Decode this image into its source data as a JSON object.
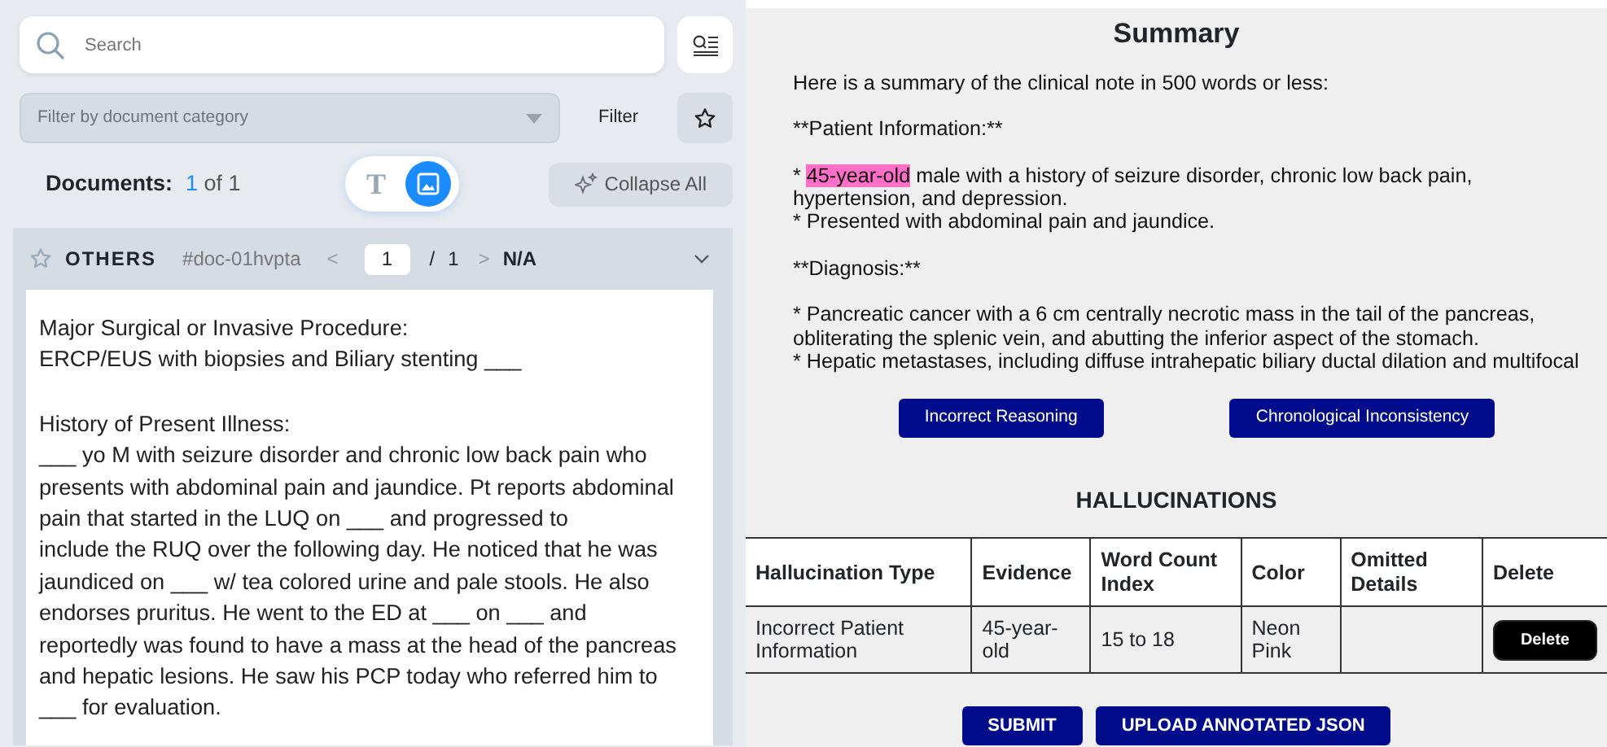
{
  "search": {
    "placeholder": "Search"
  },
  "filter": {
    "placeholder": "Filter by document category",
    "label": "Filter",
    "starred": false
  },
  "documents": {
    "label": "Documents:",
    "current": "1",
    "total": "of 1"
  },
  "view_toggle": [
    {
      "kind": "text",
      "label": "T",
      "selected": false
    },
    {
      "kind": "image",
      "selected": true
    }
  ],
  "collapse_button": "Collapse All",
  "document": {
    "starred": false,
    "category": "OTHERS",
    "id": "#doc-01hvpta",
    "prev": "<",
    "page": "1",
    "separator": "/",
    "pages": "1",
    "next": ">",
    "status": "N/A",
    "expanded": true,
    "paragraphs": [
      [
        "Major Surgical or Invasive Procedure:",
        "ERCP/EUS with biopsies and Biliary stenting ___"
      ],
      [
        "History of Present Illness:",
        "___ yo M with seizure disorder and chronic low back pain who",
        "presents with abdominal pain and jaundice. Pt reports abdominal",
        "pain that started in the LUQ on ___ and progressed to",
        "include the RUQ over the following day. He noticed that he was",
        "jaundiced on ___ w/ tea colored urine and pale stools. He also",
        "endorses pruritus. He went to the ED at ___ on ___ and",
        "reportedly was found to have a mass at the head of the pancreas",
        "and hepatic lesions. He saw his PCP today who referred him to",
        "___ for evaluation."
      ]
    ]
  },
  "summary": {
    "title": "Summary",
    "paragraphs": [
      [
        [
          {
            "text": "Here is a summary of the clinical note in 500 words or less:",
            "highlighted": false
          }
        ]
      ],
      [
        [
          {
            "text": "**Patient Information:**",
            "highlighted": false
          }
        ]
      ],
      [
        [
          {
            "text": "* ",
            "highlighted": false
          },
          {
            "text": "45-year-old",
            "highlighted": true,
            "color": "#ff6ec7"
          },
          {
            "text": " male with a history of seizure disorder, chronic low back pain, hypertension, and depression.",
            "highlighted": false
          }
        ],
        [
          {
            "text": "* Presented with abdominal pain and jaundice.",
            "highlighted": false
          }
        ]
      ],
      [
        [
          {
            "text": "**Diagnosis:**",
            "highlighted": false
          }
        ]
      ],
      [
        [
          {
            "text": "* Pancreatic cancer with a 6 cm centrally necrotic mass in the tail of the pancreas, obliterating the splenic vein, and abutting the inferior aspect of the stomach.",
            "highlighted": false
          }
        ],
        [
          {
            "text": "* Hepatic metastases, including diffuse intrahepatic biliary ductal dilation and multifocal",
            "highlighted": false
          }
        ]
      ]
    ]
  },
  "category_buttons": [
    "Incorrect Reasoning",
    "Chronological Inconsistency"
  ],
  "hallucinations": {
    "title": "HALLUCINATIONS",
    "columns": [
      "Hallucination Type",
      "Evidence",
      "Word Count Index",
      "Color",
      "Omitted Details",
      "Delete"
    ],
    "rows": [
      {
        "type": "Incorrect Patient Information",
        "evidence": "45-year-old",
        "index": "15 to 18",
        "color_name": "Neon Pink",
        "delete": "Delete"
      }
    ]
  },
  "actions": [
    "SUBMIT",
    "UPLOAD ANNOTATED JSON"
  ]
}
